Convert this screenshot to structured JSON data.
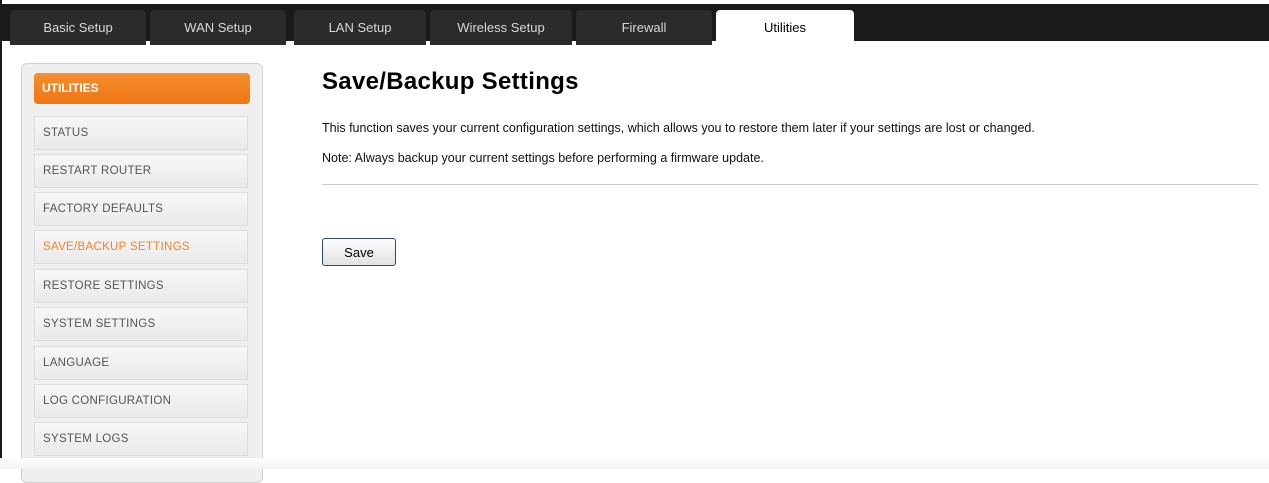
{
  "tabs": [
    {
      "label": "Basic Setup",
      "active": false
    },
    {
      "label": "WAN Setup",
      "active": false
    },
    {
      "label": "LAN Setup",
      "active": false
    },
    {
      "label": "Wireless Setup",
      "active": false
    },
    {
      "label": "Firewall",
      "active": false
    },
    {
      "label": "Utilities",
      "active": true
    }
  ],
  "sidebar": {
    "header": "UTILITIES",
    "items": [
      {
        "label": "STATUS",
        "active": false
      },
      {
        "label": "RESTART ROUTER",
        "active": false
      },
      {
        "label": "FACTORY DEFAULTS",
        "active": false
      },
      {
        "label": "SAVE/BACKUP SETTINGS",
        "active": true
      },
      {
        "label": "RESTORE SETTINGS",
        "active": false
      },
      {
        "label": "SYSTEM SETTINGS",
        "active": false
      },
      {
        "label": "LANGUAGE",
        "active": false
      },
      {
        "label": "LOG CONFIGURATION",
        "active": false
      },
      {
        "label": "SYSTEM LOGS",
        "active": false
      }
    ]
  },
  "main": {
    "title": "Save/Backup Settings",
    "description": "This function saves your current configuration settings, which allows you to restore them later if your settings are lost or changed.",
    "note": "Note: Always backup your current settings before performing a firmware update.",
    "save_label": "Save"
  },
  "colors": {
    "accent": "#f58220",
    "tabbar": "#1a1a1a"
  }
}
